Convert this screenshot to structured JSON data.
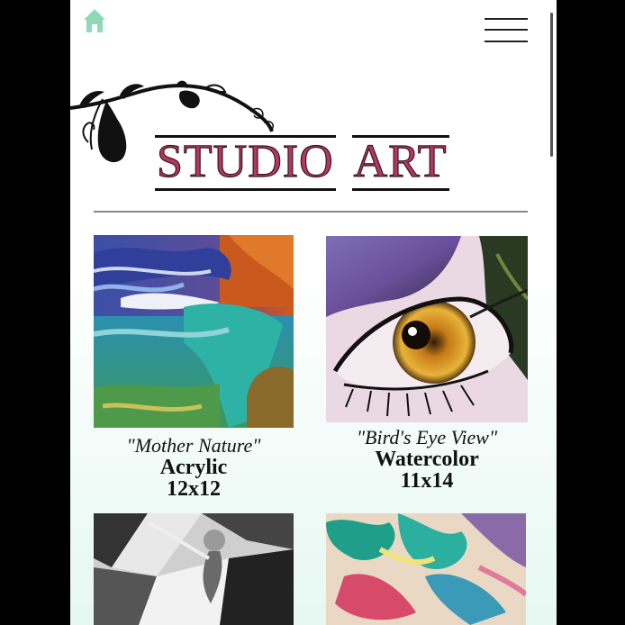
{
  "header": {
    "home_icon": "home-icon",
    "menu_icon": "hamburger-menu-icon",
    "title_words": [
      "STUDIO",
      "ART"
    ],
    "title_color": "#b3385f"
  },
  "gallery": [
    {
      "name": "\"Mother Nature\"",
      "medium": "Acrylic",
      "size": "12x12"
    },
    {
      "name": "\"Bird's Eye View\"",
      "medium": "Watercolor",
      "size": "11x14"
    },
    {
      "name": "",
      "medium": "",
      "size": ""
    },
    {
      "name": "",
      "medium": "",
      "size": ""
    }
  ],
  "colors": {
    "accent": "#8fd9b8",
    "background_bottom": "#e6f8f2"
  }
}
